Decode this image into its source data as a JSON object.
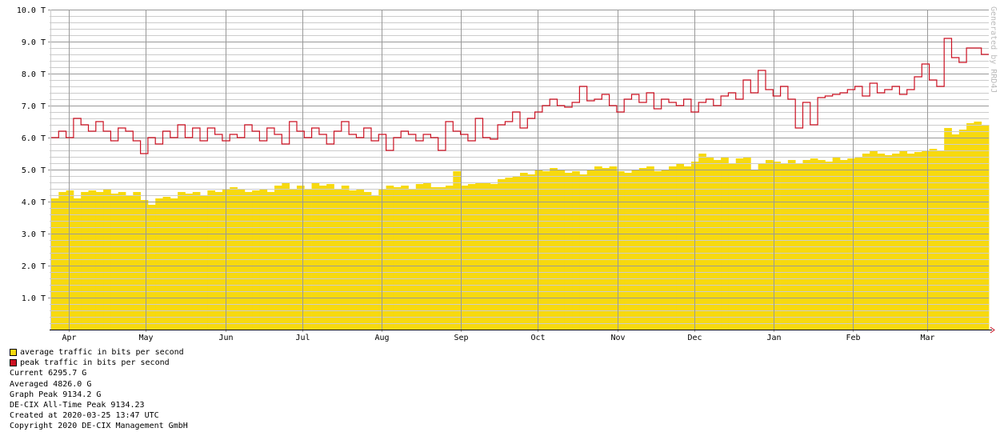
{
  "chart_data": {
    "type": "area",
    "title": "",
    "xlabel": "",
    "ylabel": "",
    "ylim": [
      0,
      10
    ],
    "xlim_days": [
      0,
      366
    ],
    "y_ticks": [
      {
        "v": 1,
        "label": "1.0 T"
      },
      {
        "v": 2,
        "label": "2.0 T"
      },
      {
        "v": 3,
        "label": "3.0 T"
      },
      {
        "v": 4,
        "label": "4.0 T"
      },
      {
        "v": 5,
        "label": "5.0 T"
      },
      {
        "v": 6,
        "label": "6.0 T"
      },
      {
        "v": 7,
        "label": "7.0 T"
      },
      {
        "v": 8,
        "label": "8.0 T"
      },
      {
        "v": 9,
        "label": "9.0 T"
      },
      {
        "v": 10,
        "label": "10.0 T"
      }
    ],
    "x_ticks": [
      {
        "day": 7,
        "label": "Apr"
      },
      {
        "day": 37,
        "label": "May"
      },
      {
        "day": 68,
        "label": "Jun"
      },
      {
        "day": 98,
        "label": "Jul"
      },
      {
        "day": 129,
        "label": "Aug"
      },
      {
        "day": 160,
        "label": "Sep"
      },
      {
        "day": 190,
        "label": "Oct"
      },
      {
        "day": 221,
        "label": "Nov"
      },
      {
        "day": 251,
        "label": "Dec"
      },
      {
        "day": 282,
        "label": "Jan"
      },
      {
        "day": 313,
        "label": "Feb"
      },
      {
        "day": 342,
        "label": "Mar"
      }
    ],
    "grid": true,
    "series": [
      {
        "name": "average traffic in bits per second",
        "color": "#F7D90F",
        "style": "area",
        "values": [
          4.1,
          4.3,
          4.35,
          4.1,
          4.3,
          4.35,
          4.3,
          4.4,
          4.25,
          4.3,
          4.2,
          4.3,
          4.05,
          3.9,
          4.1,
          4.15,
          4.1,
          4.3,
          4.25,
          4.3,
          4.2,
          4.35,
          4.3,
          4.4,
          4.45,
          4.4,
          4.3,
          4.35,
          4.4,
          4.3,
          4.5,
          4.6,
          4.4,
          4.5,
          4.4,
          4.6,
          4.5,
          4.55,
          4.4,
          4.5,
          4.35,
          4.4,
          4.3,
          4.2,
          4.4,
          4.5,
          4.45,
          4.5,
          4.4,
          4.55,
          4.6,
          4.45,
          4.45,
          4.5,
          4.95,
          4.5,
          4.55,
          4.6,
          4.6,
          4.55,
          4.7,
          4.75,
          4.8,
          4.9,
          4.85,
          5.0,
          4.95,
          5.05,
          5.0,
          4.9,
          4.95,
          4.85,
          5.0,
          5.1,
          5.05,
          5.1,
          4.95,
          4.9,
          5.0,
          5.05,
          5.1,
          4.95,
          5.0,
          5.1,
          5.2,
          5.1,
          5.25,
          5.5,
          5.4,
          5.3,
          5.4,
          5.2,
          5.35,
          5.4,
          5.0,
          5.2,
          5.3,
          5.25,
          5.2,
          5.3,
          5.2,
          5.3,
          5.35,
          5.3,
          5.25,
          5.4,
          5.3,
          5.35,
          5.4,
          5.5,
          5.6,
          5.5,
          5.45,
          5.5,
          5.6,
          5.5,
          5.55,
          5.6,
          5.65,
          5.6,
          6.3,
          6.1,
          6.25,
          6.45,
          6.5,
          6.4
        ]
      },
      {
        "name": "peak traffic in bits per second",
        "color": "#CC1122",
        "style": "step-line",
        "values": [
          6.0,
          6.2,
          6.0,
          6.6,
          6.4,
          6.2,
          6.5,
          6.2,
          5.9,
          6.3,
          6.2,
          5.9,
          5.5,
          6.0,
          5.8,
          6.2,
          6.0,
          6.4,
          6.0,
          6.3,
          5.9,
          6.3,
          6.1,
          5.9,
          6.1,
          6.0,
          6.4,
          6.2,
          5.9,
          6.3,
          6.1,
          5.8,
          6.5,
          6.2,
          6.0,
          6.3,
          6.1,
          5.8,
          6.2,
          6.5,
          6.1,
          6.0,
          6.3,
          5.9,
          6.1,
          5.6,
          6.0,
          6.2,
          6.1,
          5.9,
          6.1,
          6.0,
          5.6,
          6.5,
          6.2,
          6.1,
          5.9,
          6.6,
          6.0,
          5.95,
          6.4,
          6.5,
          6.8,
          6.3,
          6.6,
          6.8,
          7.0,
          7.2,
          7.0,
          6.95,
          7.1,
          7.6,
          7.15,
          7.2,
          7.35,
          7.0,
          6.8,
          7.2,
          7.35,
          7.1,
          7.4,
          6.9,
          7.2,
          7.1,
          7.0,
          7.2,
          6.8,
          7.1,
          7.2,
          7.0,
          7.3,
          7.4,
          7.2,
          7.8,
          7.4,
          8.1,
          7.5,
          7.3,
          7.6,
          7.2,
          6.3,
          7.1,
          6.4,
          7.25,
          7.3,
          7.35,
          7.4,
          7.5,
          7.6,
          7.3,
          7.7,
          7.4,
          7.5,
          7.6,
          7.35,
          7.5,
          7.9,
          8.3,
          7.8,
          7.6,
          9.1,
          8.5,
          8.35,
          8.8,
          8.8,
          8.6
        ]
      }
    ],
    "legend_placement": "bottom-left",
    "watermark": "Generated by RRD4J"
  },
  "stats": {
    "current": "Current 6295.7 G",
    "averaged": "Averaged 4826.0 G",
    "graph_peak": "Graph Peak 9134.2 G",
    "all_time_peak": "DE-CIX All-Time Peak 9134.23",
    "created": "Created at 2020-03-25 13:47 UTC",
    "copyright": "Copyright 2020 DE-CIX Management GmbH"
  }
}
